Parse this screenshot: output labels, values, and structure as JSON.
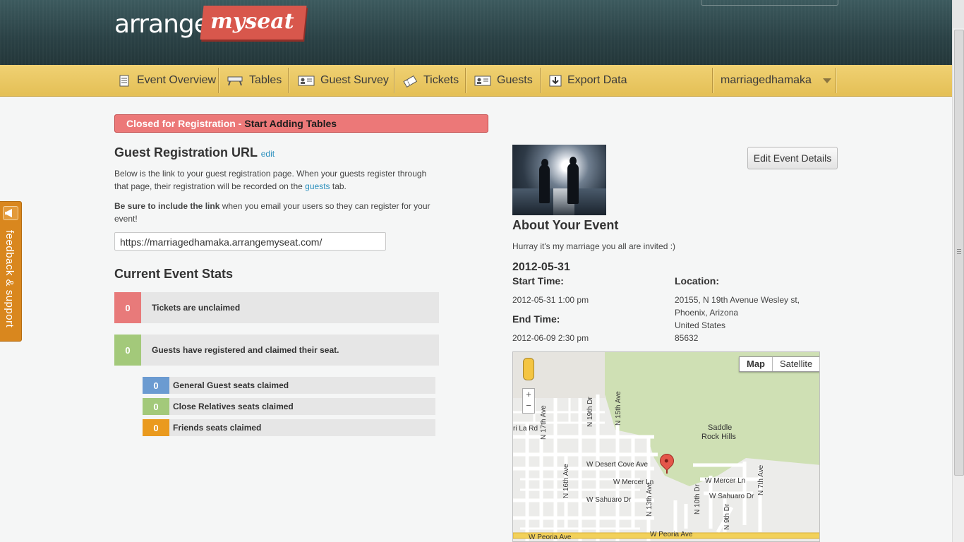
{
  "logo": {
    "part1": "arrange",
    "part2": "myseat"
  },
  "nav": {
    "items": [
      {
        "label": "Event Overview",
        "icon": "document-icon"
      },
      {
        "label": "Tables",
        "icon": "table-icon"
      },
      {
        "label": "Guest Survey",
        "icon": "id-card-icon"
      },
      {
        "label": "Tickets",
        "icon": "ticket-icon"
      },
      {
        "label": "Guests",
        "icon": "guest-card-icon"
      },
      {
        "label": "Export Data",
        "icon": "download-icon"
      }
    ],
    "user": "marriagedhamaka"
  },
  "feedback": {
    "label": "feedback & support"
  },
  "banner": {
    "status": "Closed for Registration -",
    "action": "Start Adding Tables"
  },
  "registration": {
    "title": "Guest Registration URL",
    "edit": "edit",
    "desc_before": "Below is the link to your guest registration page. When your guests register through that page, their registration will be recorded on the ",
    "desc_link": "guests",
    "desc_after": " tab.",
    "note_bold": "Be sure to include the link",
    "note_rest": " when you email your users so they can register for your event!",
    "url": "https://marriagedhamaka.arrangemyseat.com/"
  },
  "stats": {
    "title": "Current Event Stats",
    "main": [
      {
        "value": "0",
        "label": "Tickets are unclaimed",
        "color": "#e87a7a"
      },
      {
        "value": "0",
        "label": "Guests have registered and claimed their seat.",
        "color": "#a3c97a"
      }
    ],
    "sub": [
      {
        "value": "0",
        "label": "General Guest seats claimed",
        "color": "#6b9bd1"
      },
      {
        "value": "0",
        "label": "Close Relatives seats claimed",
        "color": "#a3c97a"
      },
      {
        "value": "0",
        "label": "Friends seats claimed",
        "color": "#ea9a1e"
      }
    ]
  },
  "event": {
    "edit_button": "Edit Event Details",
    "about_title": "About Your Event",
    "description": "Hurray it's my marriage you all are invited :)",
    "date": "2012-05-31",
    "start_label": "Start Time:",
    "start_value": "2012-05-31 1:00 pm",
    "end_label": "End Time:",
    "end_value": "2012-06-09 2:30 pm",
    "location_label": "Location:",
    "location_lines": [
      "20155, N 19th Avenue Wesley st,",
      "Phoenix, Arizona",
      "United States",
      "85632"
    ]
  },
  "map": {
    "toggle_map": "Map",
    "toggle_satellite": "Satellite",
    "zoom_in": "+",
    "zoom_out": "−",
    "labels": {
      "n15th": "N 15th Ave",
      "n19th": "N 19th Dr",
      "n17th": "N 17th Ave",
      "la_rd": "ri La Rd",
      "saddle1": "Saddle",
      "saddle2": "Rock Hills",
      "desert": "W Desert Cove Ave",
      "n16th": "N 16th Ave",
      "n13th": "N 13th Ave",
      "mercer1": "W Mercer Ln",
      "mercer2": "W Mercer Ln",
      "n7th": "N 7th Ave",
      "sahuaro1": "W Sahuaro Dr",
      "sahuaro2": "W Sahuaro Dr",
      "n10th": "N 10th Dr",
      "n9th": "N 9th Dr",
      "peoria1": "W Peoria Ave",
      "peoria2": "W Peoria Ave"
    }
  }
}
